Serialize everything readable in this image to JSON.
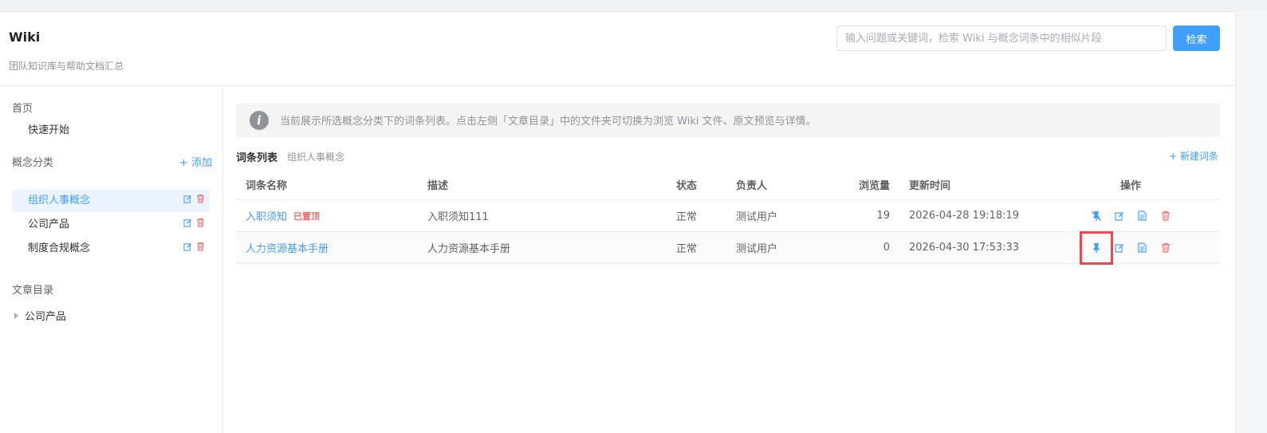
{
  "header": {
    "title": "Wiki",
    "subtitle": "团队知识库与帮助文档汇总",
    "search_placeholder": "输入问题或关键词，检索 Wiki 与概念词条中的相似片段",
    "search_button": "检索"
  },
  "sidebar": {
    "home_label": "首页",
    "quick_start": "快速开始",
    "concepts_label": "概念分类",
    "add_label": "+ 添加",
    "concepts": [
      {
        "label": "组织人事概念",
        "active": true
      },
      {
        "label": "公司产品",
        "active": false
      },
      {
        "label": "制度合规概念",
        "active": false
      }
    ],
    "articles_label": "文章目录",
    "articles": [
      {
        "label": "公司产品"
      }
    ]
  },
  "alert": {
    "icon": "info-icon",
    "text": "当前展示所选概念分类下的词条列表。点击左侧「文章目录」中的文件夹可切换为浏览 Wiki 文件、原文预览与详情。"
  },
  "list": {
    "title": "词条列表",
    "category": "组织人事概念",
    "new_button": "+ 新建词条",
    "columns": {
      "name": "词条名称",
      "desc": "描述",
      "status": "状态",
      "owner": "负责人",
      "views": "浏览量",
      "updated": "更新时间",
      "ops": "操作"
    },
    "rows": [
      {
        "name": "入职须知",
        "badge": "已置顶",
        "desc": "入职须知111",
        "status": "正常",
        "owner": "测试用户",
        "views": "19",
        "updated": "2026-04-28 19:18:19",
        "pin_action": "unpin-icon"
      },
      {
        "name": "人力资源基本手册",
        "badge": "",
        "desc": "人力资源基本手册",
        "status": "正常",
        "owner": "测试用户",
        "views": "0",
        "updated": "2026-04-30 17:53:33",
        "pin_action": "pin-icon"
      }
    ]
  },
  "colors": {
    "primary": "#409eff",
    "danger": "#f56c6c",
    "highlight": "#f0474a"
  }
}
